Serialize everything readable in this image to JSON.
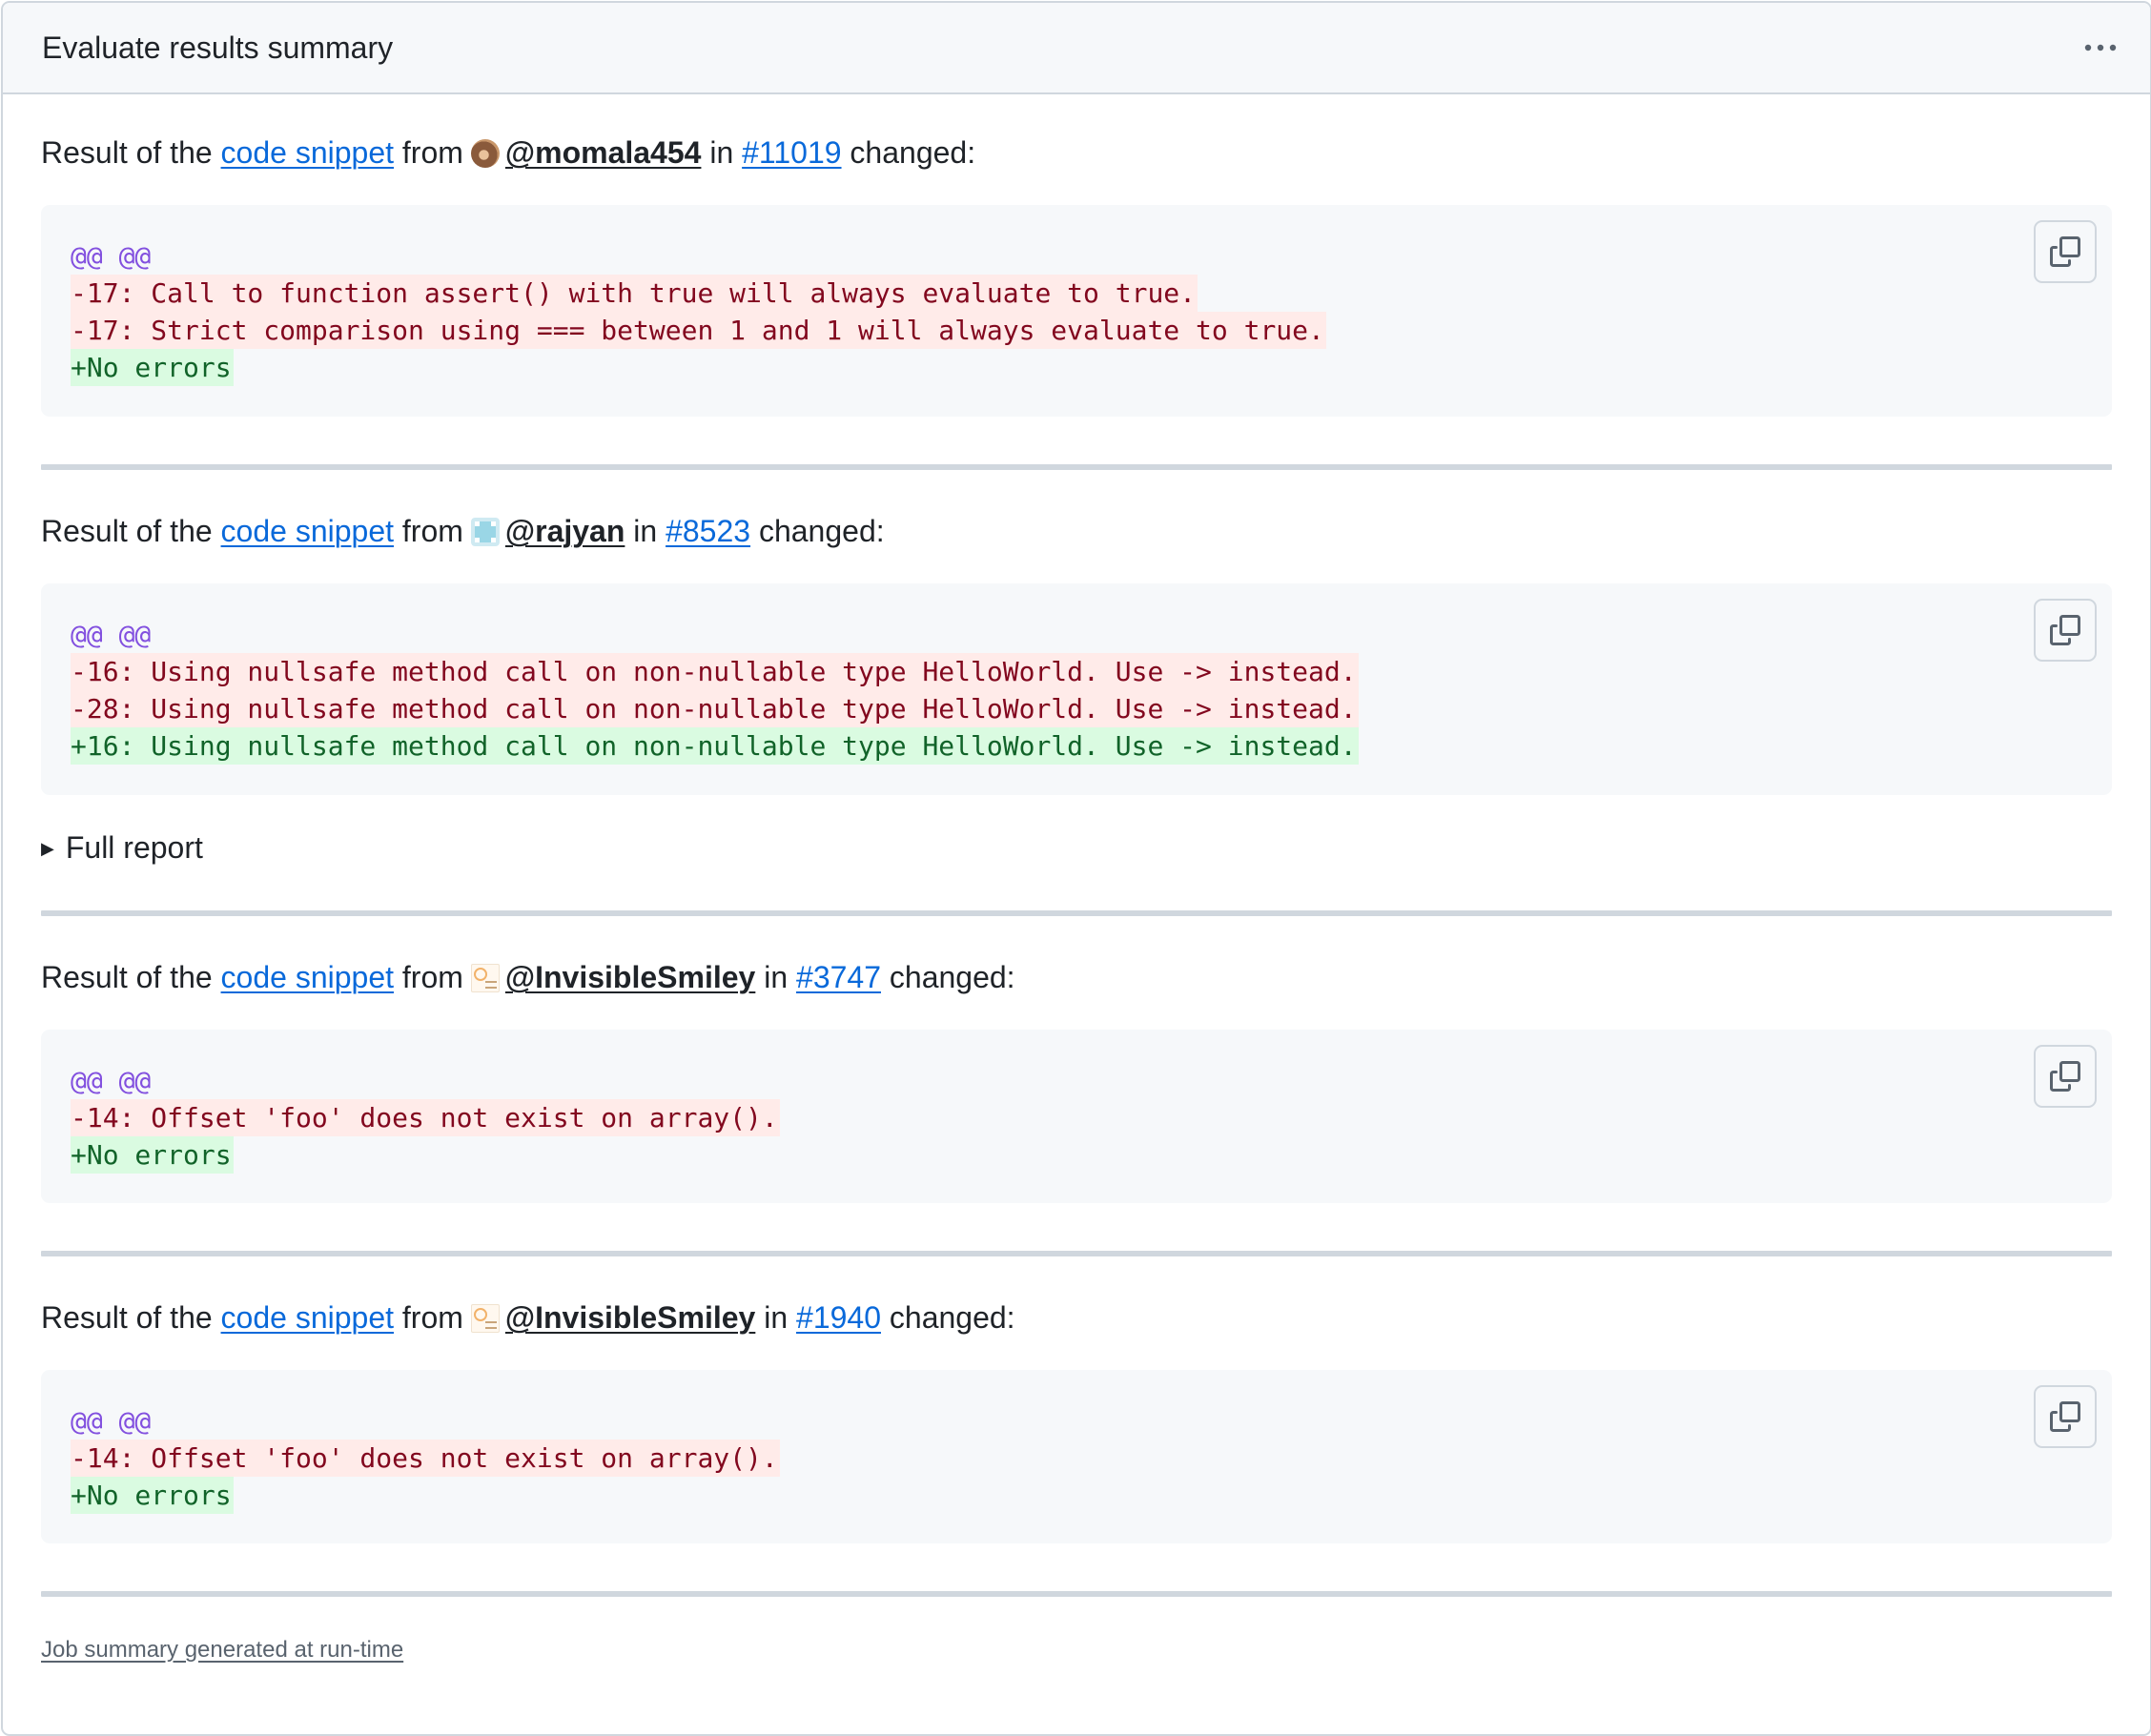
{
  "panel": {
    "title": "Evaluate results summary",
    "more_icon": "kebab-horizontal-icon"
  },
  "results": [
    {
      "prefix": "Result of the",
      "link_label": "code snippet",
      "from_word": "from",
      "user": "@momala454",
      "in_word": "in",
      "issue": "#11019",
      "suffix": "changed:",
      "diff": [
        {
          "type": "hunk",
          "text": "@@ @@"
        },
        {
          "type": "del",
          "text": "-17: Call to function assert() with true will always evaluate to true."
        },
        {
          "type": "del",
          "text": "-17: Strict comparison using === between 1 and 1 will always evaluate to true."
        },
        {
          "type": "add",
          "text": "+No errors"
        }
      ]
    },
    {
      "prefix": "Result of the",
      "link_label": "code snippet",
      "from_word": "from",
      "user": "@rajyan",
      "in_word": "in",
      "issue": "#8523",
      "suffix": "changed:",
      "diff": [
        {
          "type": "hunk",
          "text": "@@ @@"
        },
        {
          "type": "del",
          "text": "-16: Using nullsafe method call on non-nullable type HelloWorld. Use -> instead."
        },
        {
          "type": "del",
          "text": "-28: Using nullsafe method call on non-nullable type HelloWorld. Use -> instead."
        },
        {
          "type": "add",
          "text": "+16: Using nullsafe method call on non-nullable type HelloWorld. Use -> instead."
        }
      ],
      "details_label": "Full report"
    },
    {
      "prefix": "Result of the",
      "link_label": "code snippet",
      "from_word": "from",
      "user": "@InvisibleSmiley",
      "in_word": "in",
      "issue": "#3747",
      "suffix": "changed:",
      "diff": [
        {
          "type": "hunk",
          "text": "@@ @@"
        },
        {
          "type": "del",
          "text": "-14: Offset 'foo' does not exist on array()."
        },
        {
          "type": "add",
          "text": "+No errors"
        }
      ]
    },
    {
      "prefix": "Result of the",
      "link_label": "code snippet",
      "from_word": "from",
      "user": "@InvisibleSmiley",
      "in_word": "in",
      "issue": "#1940",
      "suffix": "changed:",
      "diff": [
        {
          "type": "hunk",
          "text": "@@ @@"
        },
        {
          "type": "del",
          "text": "-14: Offset 'foo' does not exist on array()."
        },
        {
          "type": "add",
          "text": "+No errors"
        }
      ]
    }
  ],
  "footer": {
    "note": "Job summary generated at run-time"
  },
  "colors": {
    "link": "#0969da",
    "hunk": "#8250df",
    "deleted_text": "#82071e",
    "deleted_bg": "#ffebe9",
    "added_text": "#116329",
    "added_bg": "#dafbe1",
    "border": "#d0d7de",
    "code_bg": "#f6f8fa"
  },
  "icons": {
    "copy": "copy-icon",
    "disclosure": "triangle-right-icon"
  }
}
